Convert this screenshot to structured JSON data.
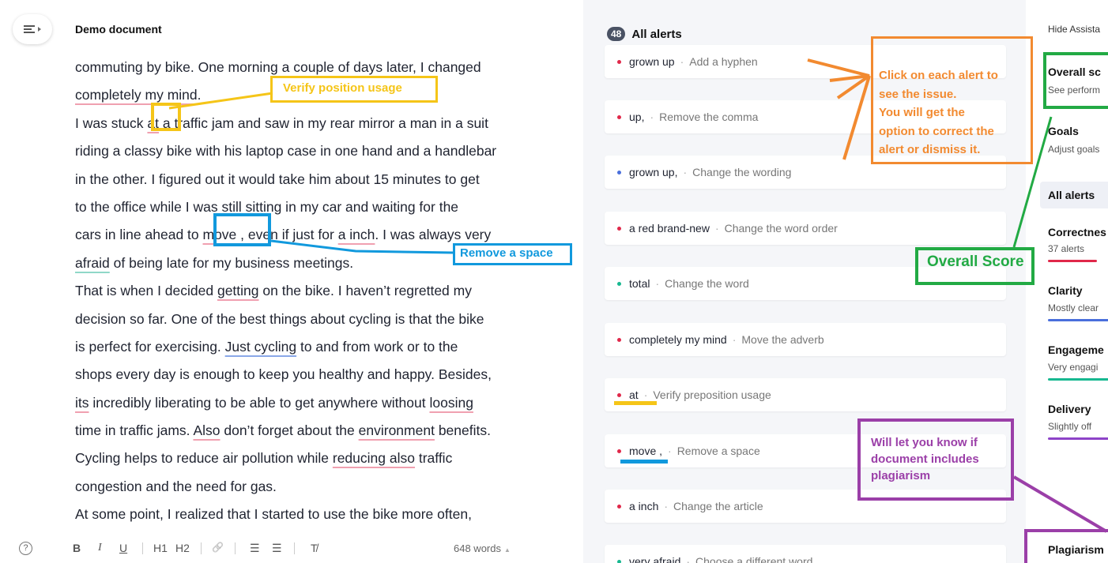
{
  "editor": {
    "doc_title": "Demo document",
    "lines": [
      [
        {
          "t": "commuting by bike. One morning a couple of days later, I changed"
        }
      ],
      [
        {
          "t": "completely my mind",
          "u": "r"
        },
        {
          "t": "."
        }
      ],
      [
        {
          "t": "I was stuck "
        },
        {
          "t": "at",
          "u": "r"
        },
        {
          "t": " a traffic jam and saw in my rear mirror a man in a suit"
        }
      ],
      [
        {
          "t": "riding a classy bike with his laptop case in one hand and a handlebar"
        }
      ],
      [
        {
          "t": "in the other. I figured out it would take him about 15 minutes to get"
        }
      ],
      [
        {
          "t": "to the office while I was still sitting in my car and waiting for the"
        }
      ],
      [
        {
          "t": "cars in line ahead to "
        },
        {
          "t": "move ,",
          "u": "r"
        },
        {
          "t": " even if just for "
        },
        {
          "t": "a inch",
          "u": "r"
        },
        {
          "t": ". I was always very"
        }
      ],
      [
        {
          "t": "afraid",
          "u": "g"
        },
        {
          "t": " of being late for my business meetings."
        }
      ],
      [
        {
          "t": "That is when I decided "
        },
        {
          "t": "getting",
          "u": "r"
        },
        {
          "t": " on the bike. I haven’t regretted my"
        }
      ],
      [
        {
          "t": "decision so far. One of the best things about cycling is that the bike"
        }
      ],
      [
        {
          "t": "is perfect for exercising. "
        },
        {
          "t": "Just cycling",
          "u": "b"
        },
        {
          "t": " to and from work or to the"
        }
      ],
      [
        {
          "t": "shops every day is enough to keep you healthy and happy. Besides,"
        }
      ],
      [
        {
          "t": "its",
          "u": "r"
        },
        {
          "t": " incredibly liberating to be able to get anywhere without "
        },
        {
          "t": "loosing",
          "u": "r"
        }
      ],
      [
        {
          "t": "time in traffic jams. "
        },
        {
          "t": "Also",
          "u": "r"
        },
        {
          "t": " don’t forget about the "
        },
        {
          "t": "environment",
          "u": "r"
        },
        {
          "t": " benefits."
        }
      ],
      [
        {
          "t": "Cycling helps to reduce air pollution while "
        },
        {
          "t": "reducing also",
          "u": "r"
        },
        {
          "t": " traffic"
        }
      ],
      [
        {
          "t": "congestion and the need for gas."
        }
      ],
      [
        {
          "t": "At some point, I realized that I started to use the bike more often,"
        }
      ]
    ],
    "toolbar": {
      "help": "?",
      "bold": "B",
      "italic": "I",
      "underline": "U",
      "h1": "H1",
      "h2": "H2",
      "link": "🔗",
      "ordered_list": "☰",
      "bullet_list": "☰",
      "clear_format": "T̸"
    },
    "word_count": "648 words",
    "word_count_caret": "▲"
  },
  "alerts": {
    "count": "48",
    "title": "All alerts",
    "items": [
      {
        "word": "grown up",
        "desc": "Add a hyphen",
        "color": "#e0284a"
      },
      {
        "word": "up,",
        "desc": "Remove the comma",
        "color": "#e0284a"
      },
      {
        "word": "grown up,",
        "desc": "Change the wording",
        "color": "#4a6fdc"
      },
      {
        "word": "a red brand-new",
        "desc": "Change the word order",
        "color": "#e0284a"
      },
      {
        "word": "total",
        "desc": "Change the word",
        "color": "#17b890"
      },
      {
        "word": "completely my mind",
        "desc": "Move the adverb",
        "color": "#e0284a"
      },
      {
        "word": "at",
        "desc": "Verify preposition usage",
        "color": "#e0284a"
      },
      {
        "word": "move ,",
        "desc": "Remove a space",
        "color": "#e0284a"
      },
      {
        "word": "a inch",
        "desc": "Change the article",
        "color": "#e0284a"
      },
      {
        "word": "very afraid",
        "desc": "Choose a different word",
        "color": "#17b890"
      }
    ],
    "separator": "·"
  },
  "sidebar": {
    "hide_assistant": "Hide Assista",
    "overall_title": "Overall sc",
    "overall_sub": "See perform",
    "goals_title": "Goals",
    "goals_sub": "Adjust goals",
    "all_alerts": "All alerts",
    "correctness_title": "Correctnes",
    "correctness_sub": "37 alerts",
    "clarity_title": "Clarity",
    "clarity_sub": "Mostly clear",
    "engagement_title": "Engageme",
    "engagement_sub": "Very engagi",
    "delivery_title": "Delivery",
    "delivery_sub": "Slightly off",
    "plagiarism_title": "Plagiarism",
    "colors": {
      "correctness": "#e0284a",
      "clarity": "#4a6fdc",
      "engagement": "#17b890",
      "delivery": "#8e44c8"
    }
  },
  "annotations": {
    "verify_position": "Verify position usage",
    "remove_space": "Remove a space",
    "click_alert": [
      "Click on each alert to",
      "see the issue.",
      "You will get the",
      "option to correct the",
      "alert or dismiss it."
    ],
    "overall_score": "Overall Score",
    "plagiarism": [
      "Will let you know if",
      "document includes",
      "plagiarism"
    ],
    "colors": {
      "yellow": "#f5c518",
      "blue": "#1199dd",
      "orange": "#f28a30",
      "green": "#22aa44",
      "purple": "#9b3fa8"
    }
  }
}
